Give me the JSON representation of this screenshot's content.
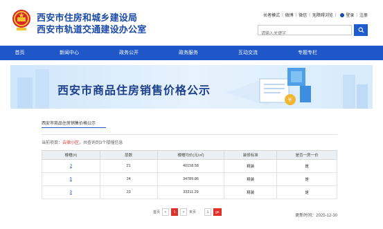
{
  "header": {
    "title_line1": "西安市住房和城乡建设局",
    "title_line2": "西安市轨道交通建设办公室",
    "links": [
      "长者模式",
      "微博",
      "微信",
      "无障碍浏览",
      "登录",
      "注册"
    ],
    "search_placeholder": "请输入关键字"
  },
  "nav": {
    "items": [
      "首页",
      "新闻中心",
      "政务公开",
      "政务服务",
      "互动交流",
      "专题专栏"
    ]
  },
  "banner": {
    "title": "西安市商品住房销售价格公示"
  },
  "content": {
    "tab_label": "西安市商品住房销售价格公示",
    "project_prefix": "当前项目：",
    "project_name": "云律小区",
    "project_suffix": "，共查询到3个楼幢信息"
  },
  "table": {
    "headers": [
      "楼幢(#)",
      "层数",
      "楼幢均价(元/㎡)",
      "装修标准",
      "是否一房一价"
    ],
    "rows": [
      [
        "3",
        "21",
        "40158.58",
        "精装",
        "是"
      ],
      [
        "5",
        "24",
        "34789.86",
        "精装",
        "是"
      ],
      [
        "9",
        "23",
        "33211.29",
        "精装",
        "是"
      ]
    ]
  },
  "pager": {
    "first": "首页",
    "prev": "<",
    "current": "1",
    "next": ">",
    "last": "末页",
    "jump_value": "1",
    "go": "go"
  },
  "footer": {
    "update_text": "更新时间：2025-12-30"
  },
  "colors": {
    "brand_blue": "#1f57c8",
    "title_blue": "#1b4aa8",
    "accent_red": "#e0312a"
  }
}
